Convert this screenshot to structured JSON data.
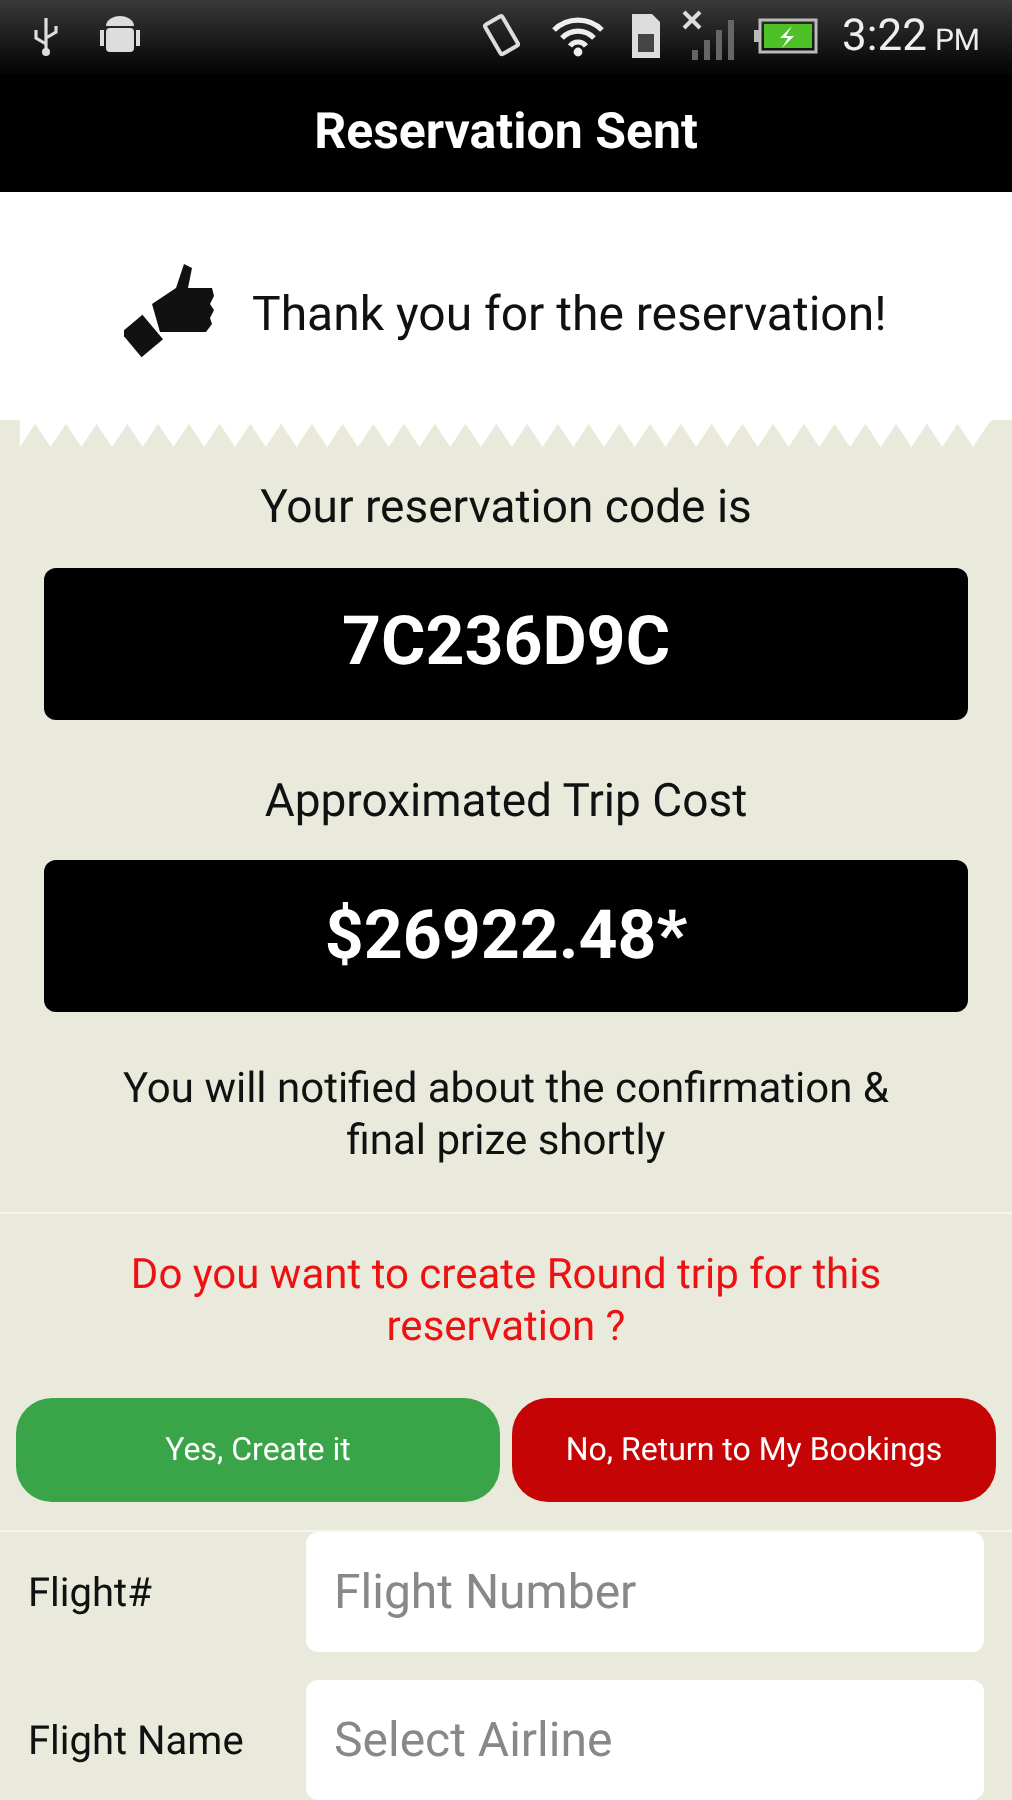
{
  "status_bar": {
    "time": "3:22",
    "ampm": "PM"
  },
  "title": "Reservation Sent",
  "thanks": "Thank you for the reservation!",
  "code": {
    "label": "Your reservation code is",
    "value": "7C236D9C"
  },
  "cost": {
    "label": "Approximated Trip Cost",
    "value": "$26922.48*"
  },
  "notice": "You will notified about the confirmation & final prize shortly",
  "question": "Do you want to create Round trip for this reservation ?",
  "buttons": [
    {
      "label": "Yes, Create it",
      "kind": "confirm"
    },
    {
      "label": "No, Return to My Bookings",
      "kind": "cancel"
    }
  ],
  "form": [
    {
      "label": "Flight#",
      "placeholder": "Flight Number"
    },
    {
      "label": "Flight Name",
      "placeholder": "Select Airline"
    }
  ]
}
